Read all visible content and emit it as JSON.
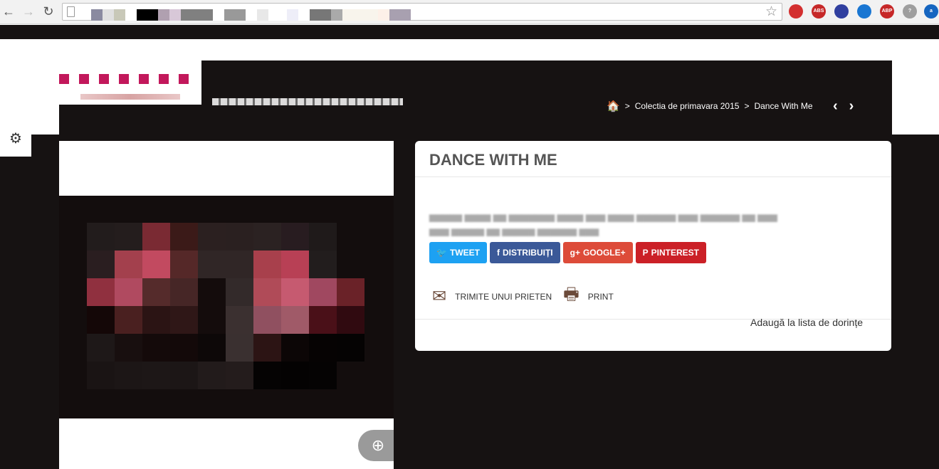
{
  "browser": {
    "back_icon": "arrow-left-icon",
    "forward_icon": "arrow-right-icon",
    "reload_icon": "reload-icon",
    "extensions": [
      {
        "name": "stop-icon",
        "label": "",
        "color": "#d32f2f"
      },
      {
        "name": "abs-icon",
        "label": "ABS",
        "color": "#c62828"
      },
      {
        "name": "speed-icon",
        "label": "",
        "color": "#303f9f"
      },
      {
        "name": "check-icon",
        "label": "",
        "color": "#1976d2"
      },
      {
        "name": "abp-icon",
        "label": "ABP",
        "color": "#c62828"
      },
      {
        "name": "help-icon",
        "label": "?",
        "color": "#9e9e9e"
      },
      {
        "name": "account-icon",
        "label": "a",
        "color": "#1565c0"
      }
    ]
  },
  "breadcrumb": {
    "home_icon": "home-icon",
    "separator": ">",
    "category": "Colectia de primavara 2015",
    "current": "Dance With Me"
  },
  "product": {
    "title": "DANCE WITH ME",
    "share_buttons": [
      {
        "label": "TWEET",
        "glyph": "🐦",
        "color": "#1da1f2"
      },
      {
        "label": "DISTRIBUIȚI",
        "glyph": "f",
        "color": "#3b5998"
      },
      {
        "label": "GOOGLE+",
        "glyph": "g+",
        "color": "#dd4b39"
      },
      {
        "label": "PINTEREST",
        "glyph": "P",
        "color": "#cb2027"
      }
    ],
    "send_friend": "TRIMITE UNUI PRIETEN",
    "print": "PRINT",
    "wishlist": "Adaugă la lista de dorințe"
  }
}
